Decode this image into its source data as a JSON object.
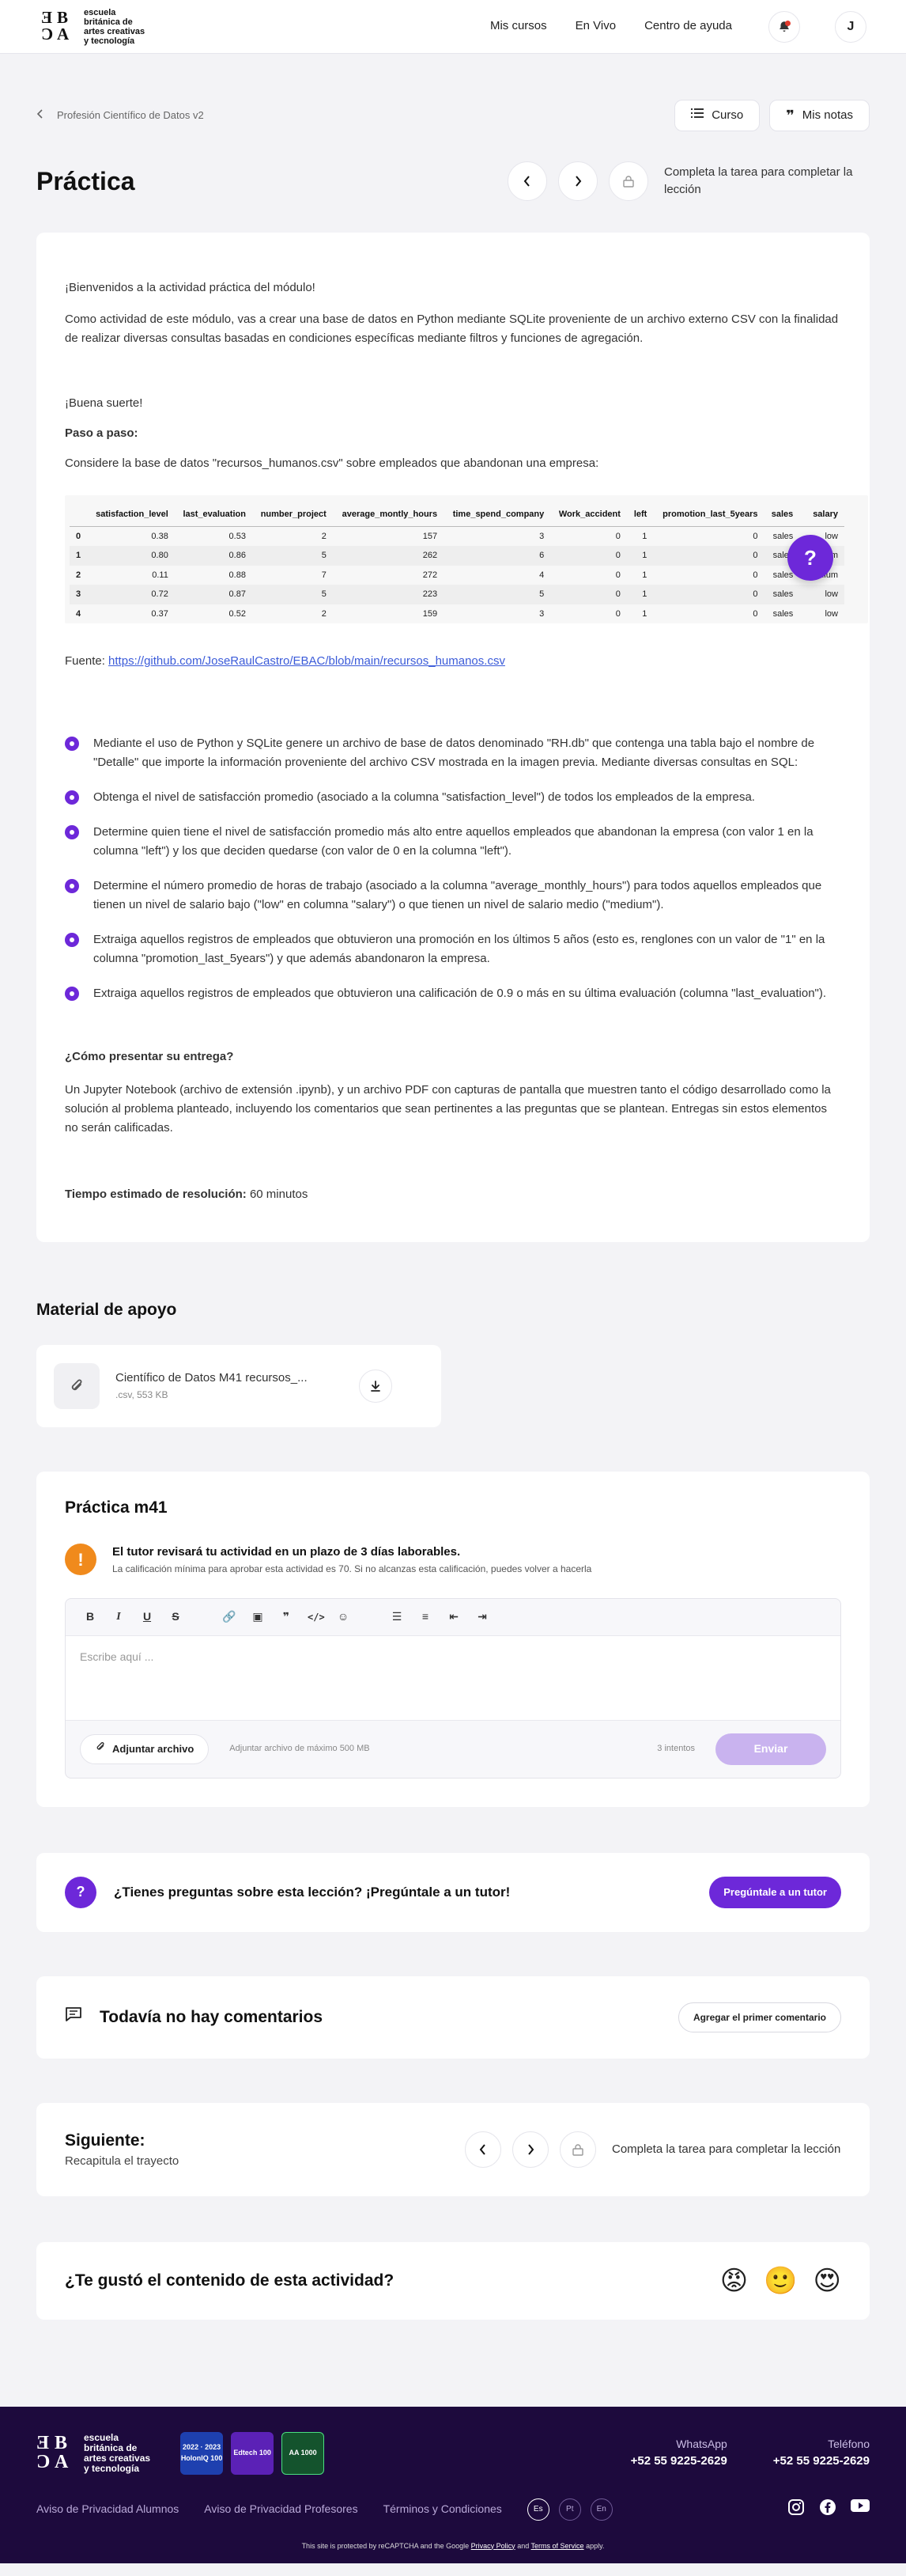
{
  "header": {
    "logo_text": [
      "escuela",
      "británica de",
      "artes creativas",
      "y tecnología"
    ],
    "nav": [
      "Mis cursos",
      "En Vivo",
      "Centro de ayuda"
    ],
    "avatar": "J"
  },
  "breadcrumb": {
    "label": "Profesión Científico de Datos v2",
    "course_button": "Curso",
    "notes_button": "Mis notas"
  },
  "page": {
    "title": "Práctica",
    "lock_text": "Completa la tarea para completar la lección"
  },
  "content": {
    "welcome": "¡Bienvenidos a la actividad práctica del módulo!",
    "intro": "Como actividad de este módulo, vas a crear una base de datos en Python mediante SQLite proveniente de un archivo externo CSV con la finalidad de realizar diversas consultas basadas en condiciones específicas mediante filtros y funciones de agregación.",
    "luck": "¡Buena suerte!",
    "steps_heading": "Paso a paso:",
    "consider": "Considere la base de datos \"recursos_humanos.csv\" sobre empleados que abandonan una empresa:",
    "table": {
      "columns": [
        "",
        "satisfaction_level",
        "last_evaluation",
        "number_project",
        "average_montly_hours",
        "time_spend_company",
        "Work_accident",
        "left",
        "promotion_last_5years",
        "sales",
        "salary"
      ],
      "rows": [
        [
          "0",
          "0.38",
          "0.53",
          "2",
          "157",
          "3",
          "0",
          "1",
          "0",
          "sales",
          "low"
        ],
        [
          "1",
          "0.80",
          "0.86",
          "5",
          "262",
          "6",
          "0",
          "1",
          "0",
          "sales",
          "medium"
        ],
        [
          "2",
          "0.11",
          "0.88",
          "7",
          "272",
          "4",
          "0",
          "1",
          "0",
          "sales",
          "medium"
        ],
        [
          "3",
          "0.72",
          "0.87",
          "5",
          "223",
          "5",
          "0",
          "1",
          "0",
          "sales",
          "low"
        ],
        [
          "4",
          "0.37",
          "0.52",
          "2",
          "159",
          "3",
          "0",
          "1",
          "0",
          "sales",
          "low"
        ]
      ]
    },
    "source_label": "Fuente: ",
    "source_link": "https://github.com/JoseRaulCastro/EBAC/blob/main/recursos_humanos.csv",
    "tasks": [
      "Mediante el uso de Python y SQLite genere un archivo de base de datos denominado \"RH.db\" que contenga una tabla bajo el nombre de \"Detalle\" que importe la información proveniente del archivo CSV mostrada en la imagen previa. Mediante diversas consultas en SQL:",
      "Obtenga el nivel de satisfacción promedio (asociado a la columna \"satisfaction_level\") de todos los empleados de la empresa.",
      "Determine quien tiene el nivel de satisfacción promedio más alto entre aquellos empleados que abandonan la empresa (con valor 1 en la columna \"left\") y los que deciden quedarse (con valor de 0 en la columna \"left\").",
      "Determine el número promedio de horas de trabajo (asociado a la columna \"average_monthly_hours\") para todos aquellos empleados que tienen un nivel de salario bajo (\"low\" en columna \"salary\") o que tienen un nivel de salario medio (\"medium\").",
      "Extraiga aquellos registros de empleados que obtuvieron una promoción en los últimos 5 años (esto es, renglones con un valor de \"1\" en la columna \"promotion_last_5years\") y que además abandonaron la empresa.",
      "Extraiga aquellos registros de empleados que obtuvieron una calificación de 0.9 o más en su última evaluación (columna \"last_evaluation\")."
    ],
    "present_heading": "¿Cómo presentar su entrega?",
    "present_text": "Un Jupyter Notebook (archivo de extensión .ipynb), y un archivo PDF con capturas de pantalla que muestren tanto el código desarrollado como la solución al problema planteado, incluyendo los comentarios que sean pertinentes a las preguntas que se plantean. Entregas sin estos elementos no serán calificadas.",
    "time_label": "Tiempo estimado de resolución:",
    "time_value": " 60 minutos"
  },
  "support": {
    "title": "Material de apoyo",
    "file_name": "Científico de Datos M41 recursos_...",
    "file_meta": ".csv, 553 KB"
  },
  "submission": {
    "title": "Práctica m41",
    "alert_strong": "El tutor revisará tu actividad en un plazo de 3 días laborables.",
    "alert_small": "La calificación mínima para aprobar esta actividad es 70. Si no alcanzas esta calificación, puedes volver a hacerla",
    "placeholder": "Escribe aquí ...",
    "attach_button": "Adjuntar archivo",
    "attach_note": "Adjuntar archivo de máximo 500 MB",
    "attempts": "3 intentos",
    "send_button": "Enviar"
  },
  "questions": {
    "text": "¿Tienes preguntas sobre esta lección? ¡Pregúntale a un tutor!",
    "button": "Pregúntale a un tutor"
  },
  "comments": {
    "text": "Todavía no hay comentarios",
    "button": "Agregar el primer comentario"
  },
  "next": {
    "title": "Siguiente:",
    "subtitle": "Recapitula el trayecto",
    "lock_text": "Completa la tarea para completar la lección"
  },
  "feedback": {
    "text": "¿Te gustó el contenido de esta actividad?",
    "emojis": [
      "😡",
      "🙂",
      "😍"
    ]
  },
  "footer": {
    "logo_text": [
      "escuela",
      "británica de",
      "artes creativas",
      "y tecnología"
    ],
    "whatsapp_label": "WhatsApp",
    "whatsapp_value": "+52 55 9225-2629",
    "phone_label": "Teléfono",
    "phone_value": "+52 55 9225-2629",
    "links": [
      "Aviso de Privacidad Alumnos",
      "Aviso de Privacidad Profesores",
      "Términos y Condiciones"
    ],
    "langs": [
      "Es",
      "Pt",
      "En"
    ],
    "badges": [
      "2022 · 2023 HolonIQ 100",
      "Edtech 100",
      "AA 1000"
    ],
    "recaptcha_prefix": "This site is protected by reCAPTCHA and the Google ",
    "privacy": "Privacy Policy",
    "and": " and ",
    "terms": "Terms of Service",
    "apply": " apply."
  },
  "colors": {
    "accent": "#6d28d9",
    "footer_bg": "#1d0a3d",
    "alert": "#f08a1c"
  }
}
